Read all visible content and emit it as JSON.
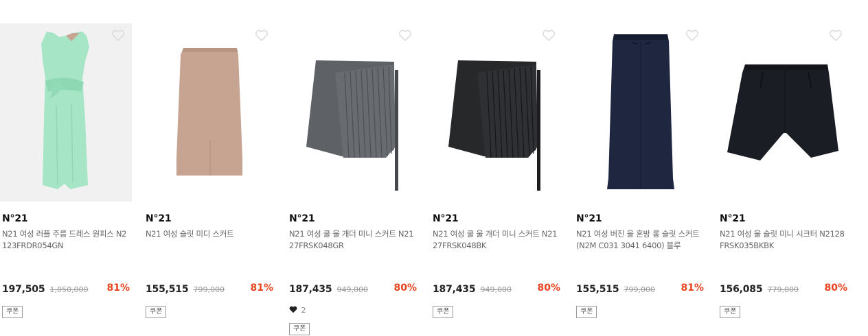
{
  "products": [
    {
      "brand": "N°21",
      "name": "N21 여성 러플 주름 드레스 원피스 N2123FRDR054GN",
      "price": "197,505",
      "original_price": "1,050,000",
      "discount": "81%",
      "coupon": "쿠폰",
      "likes": null,
      "image": "mint-dress",
      "image_bg": "#f1f1f1",
      "color": "#a6e6c6"
    },
    {
      "brand": "N°21",
      "name": "N21 여성 슬릿 미디 스커트",
      "price": "155,515",
      "original_price": "799,000",
      "discount": "81%",
      "coupon": "쿠폰",
      "likes": null,
      "image": "beige-pencil-skirt",
      "image_bg": "#ffffff",
      "color": "#c7a391"
    },
    {
      "brand": "N°21",
      "name": "N21 여성 쿨 울 개더 미니 스커트 N2127FRSK048GR",
      "price": "187,435",
      "original_price": "949,000",
      "discount": "80%",
      "coupon": "쿠폰",
      "likes": "2",
      "image": "gray-pleated-skirt",
      "image_bg": "#ffffff",
      "color": "#5e6166"
    },
    {
      "brand": "N°21",
      "name": "N21 여성 쿨 울 개더 미니 스커트 N2127FRSK048BK",
      "price": "187,435",
      "original_price": "949,000",
      "discount": "80%",
      "coupon": "쿠폰",
      "likes": null,
      "image": "black-pleated-skirt",
      "image_bg": "#ffffff",
      "color": "#26282a"
    },
    {
      "brand": "N°21",
      "name": "N21 여성 버진 울 혼방 롱 슬릿 스커트 (N2M C031 3041 6400) 블루",
      "price": "155,515",
      "original_price": "799,000",
      "discount": "81%",
      "coupon": "쿠폰",
      "likes": null,
      "image": "navy-long-skirt",
      "image_bg": "#ffffff",
      "color": "#1e2640"
    },
    {
      "brand": "N°21",
      "name": "N21 여성 울 슬릿 미니 시크터 N2128FRSK035BKBK",
      "price": "156,085",
      "original_price": "779,000",
      "discount": "80%",
      "coupon": "쿠폰",
      "likes": null,
      "image": "black-shorts",
      "image_bg": "#ffffff",
      "color": "#1a1d24"
    }
  ],
  "colors": {
    "discount": "#e8431f",
    "wish_outline": "#d9d9d9"
  }
}
